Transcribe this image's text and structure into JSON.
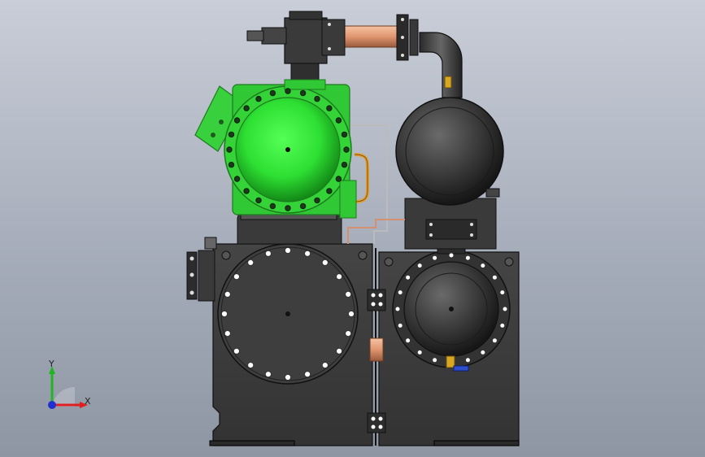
{
  "viewport": {
    "type": "cad-3d-model-view",
    "view": "front"
  },
  "model": {
    "colors": {
      "frame": "#3c3c3c",
      "frame_edge": "#1a1a1a",
      "compressor": "#33d93a",
      "compressor_edge": "#1e7a1e",
      "vessel": "#3a3a3a",
      "copper_pipe": "#e6a07a",
      "brass_fitting": "#d2a020",
      "bolt": "#ffffff",
      "background_top": "#c9ced8",
      "background_bottom": "#8e96a4"
    }
  },
  "triad": {
    "x_label": "X",
    "y_label": "Y",
    "x_color": "#e02020",
    "y_color": "#22b422",
    "z_color": "#2030d0"
  }
}
